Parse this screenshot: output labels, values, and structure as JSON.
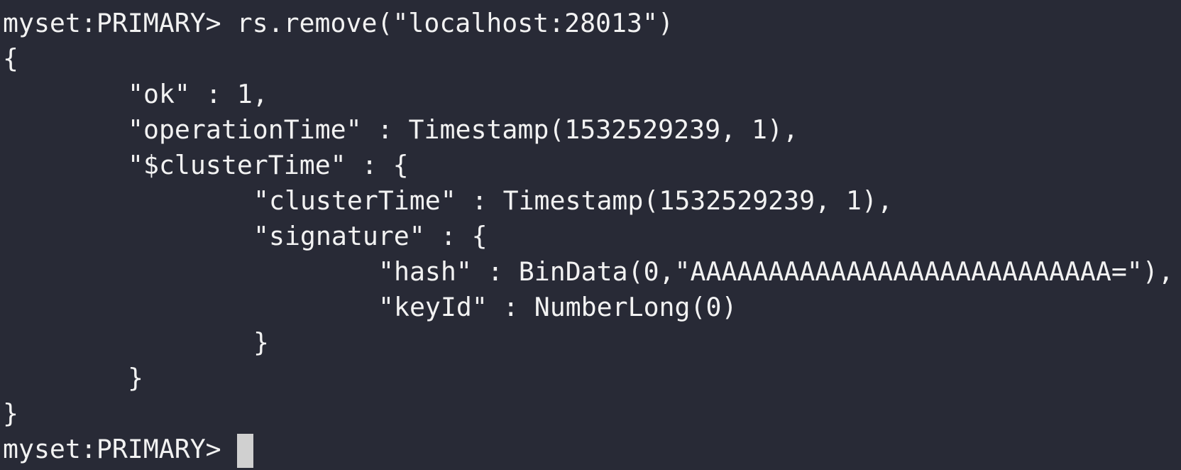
{
  "terminal": {
    "partial_top_line": "}",
    "command_line": {
      "prompt": "myset:PRIMARY>",
      "command": "rs.remove(\"localhost:28013\")"
    },
    "output_lines": [
      {
        "indent": 0,
        "text": "{"
      },
      {
        "indent": 1,
        "text": "\"ok\" : 1,"
      },
      {
        "indent": 1,
        "text": "\"operationTime\" : Timestamp(1532529239, 1),"
      },
      {
        "indent": 1,
        "text": "\"$clusterTime\" : {"
      },
      {
        "indent": 2,
        "text": "\"clusterTime\" : Timestamp(1532529239, 1),"
      },
      {
        "indent": 2,
        "text": "\"signature\" : {"
      },
      {
        "indent": 3,
        "text": "\"hash\" : BinData(0,\"AAAAAAAAAAAAAAAAAAAAAAAAAAA=\"),"
      },
      {
        "indent": 3,
        "text": "\"keyId\" : NumberLong(0)"
      },
      {
        "indent": 2,
        "text": "}"
      },
      {
        "indent": 1,
        "text": "}"
      },
      {
        "indent": 0,
        "text": "}"
      }
    ],
    "active_prompt": "myset:PRIMARY>"
  },
  "colors": {
    "background": "#282a36",
    "foreground": "#f2f2f2",
    "cursor": "#d0d0d0"
  }
}
